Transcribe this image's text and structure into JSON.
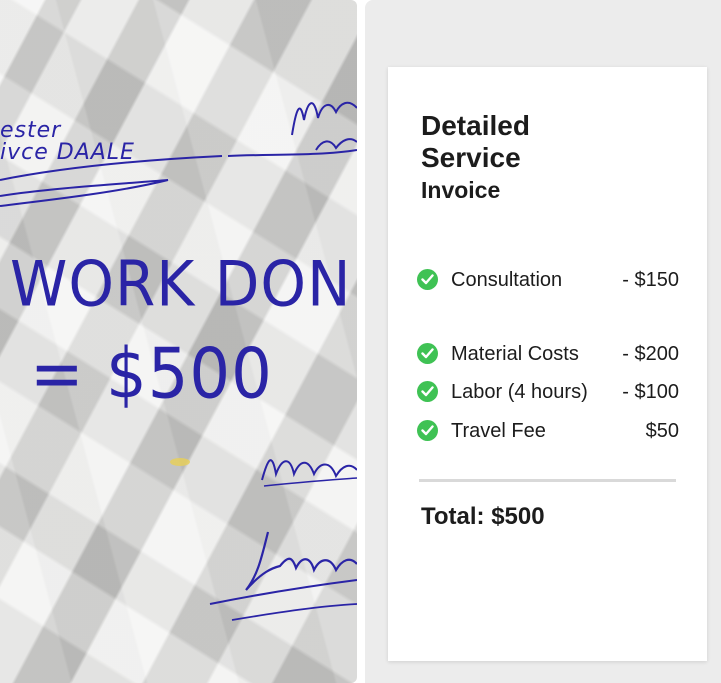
{
  "paper": {
    "main_line_1": "WORK DONE",
    "main_line_2": "= $500",
    "scribble_top_left_1": "ester",
    "scribble_top_left_2": "ivce DAALE"
  },
  "invoice": {
    "title": "Detailed Service",
    "subtitle": "Invoice",
    "items": [
      {
        "label": "Consultation",
        "amount": "- $150"
      },
      {
        "label": "Material Costs",
        "amount": "- $200"
      },
      {
        "label": "Labor (4 hours)",
        "amount": "- $100"
      },
      {
        "label": "Travel Fee",
        "amount": "$50"
      }
    ],
    "total": "Total: $500"
  },
  "colors": {
    "ink": "#2a24a6",
    "check": "#3fc254",
    "card_bg": "#ffffff",
    "panel_bg": "#ececec"
  },
  "icons": {
    "item_status": "check-circle-icon"
  }
}
